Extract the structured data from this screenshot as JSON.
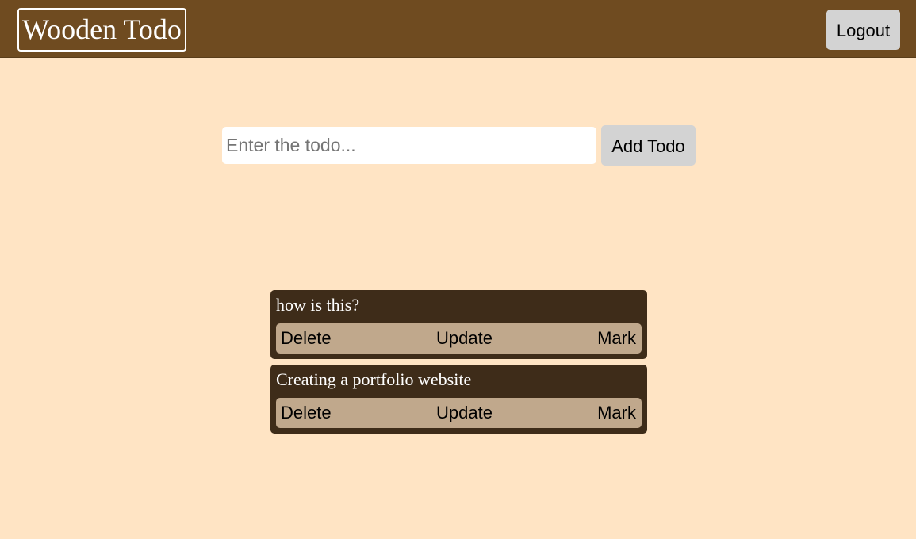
{
  "header": {
    "brand": "Wooden Todo",
    "logout_label": "Logout",
    "background": "#6f4b20"
  },
  "form": {
    "placeholder": "Enter the todo...",
    "value": "",
    "add_label": "Add Todo"
  },
  "todos": [
    {
      "text": "how is this?",
      "delete_label": "Delete",
      "update_label": "Update",
      "mark_label": "Mark"
    },
    {
      "text": "Creating a portfolio website",
      "delete_label": "Delete",
      "update_label": "Update",
      "mark_label": "Mark"
    }
  ],
  "colors": {
    "page_background": "#ffe4c4",
    "card_background": "#3e2c19",
    "actions_background": "#c0a88c",
    "button_background": "#d3d3d3"
  }
}
